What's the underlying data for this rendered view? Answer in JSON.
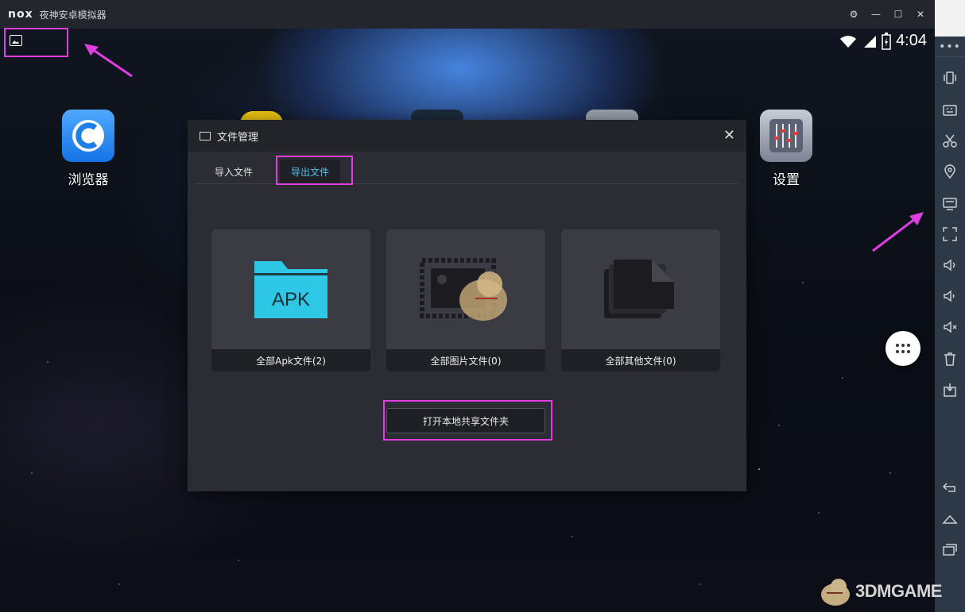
{
  "window": {
    "logo": "nox",
    "title": "夜神安卓模拟器"
  },
  "status_bar": {
    "time": "4:04"
  },
  "home": {
    "apps": [
      {
        "label": "浏览器"
      },
      {
        "label": "设置"
      }
    ]
  },
  "dialog": {
    "title": "文件管理",
    "tabs": [
      {
        "label": "导入文件"
      },
      {
        "label": "导出文件",
        "active": true
      }
    ],
    "cards": [
      {
        "caption": "全部Apk文件(2)",
        "art_text": "APK"
      },
      {
        "caption": "全部图片文件(0)"
      },
      {
        "caption": "全部其他文件(0)"
      }
    ],
    "share_button": "打开本地共享文件夹"
  },
  "watermark": "3DMGAME",
  "colors": {
    "highlight": "#e13ee0",
    "active_tab_text": "#4fc4e8",
    "apk_folder": "#2ec7e6",
    "toolbar_bg": "#2e3947"
  }
}
